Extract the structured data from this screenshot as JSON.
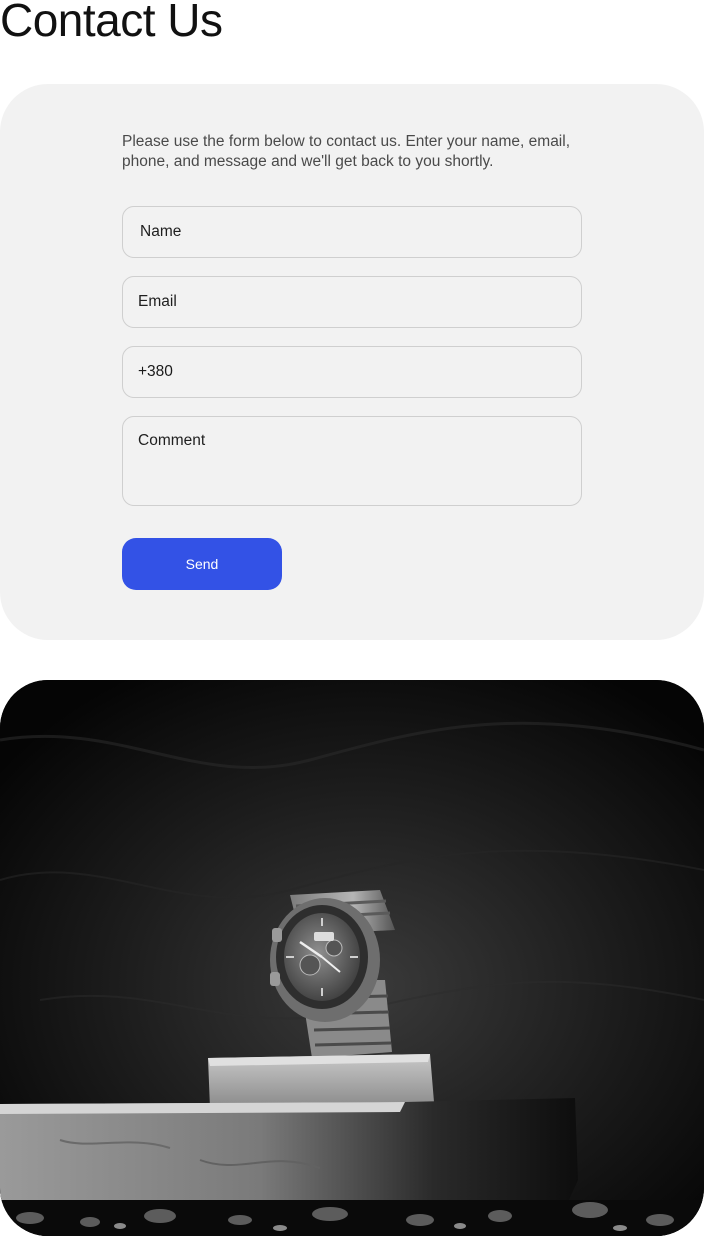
{
  "page": {
    "title": "Contact Us"
  },
  "contact_form": {
    "intro": "Please use the form below to contact us. Enter your name, email, phone, and message and we'll get back to you shortly.",
    "name_placeholder": "Name",
    "email_placeholder": "Email",
    "phone_value": "+380",
    "comment_placeholder": "Comment",
    "send_label": "Send"
  },
  "colors": {
    "card_background": "#f2f2f2",
    "accent": "#3352e6",
    "field_border": "#cfcfcf"
  },
  "hero": {
    "subject": "wristwatch on stone blocks, black and white photo"
  }
}
